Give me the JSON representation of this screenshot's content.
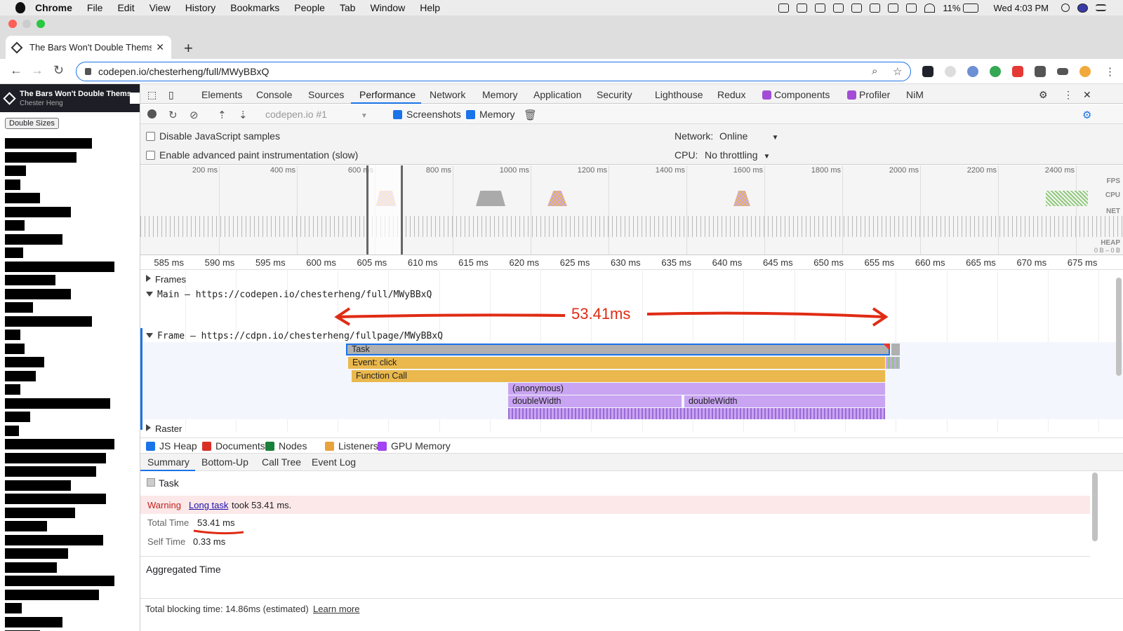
{
  "menubar": {
    "app": "Chrome",
    "items": [
      "File",
      "Edit",
      "View",
      "History",
      "Bookmarks",
      "People",
      "Tab",
      "Window",
      "Help"
    ],
    "battery": "11%",
    "clock": "Wed 4:03 PM"
  },
  "browser": {
    "tab_title": "The Bars Won't Double Thems",
    "url": "codepen.io/chesterheng/full/MWyBBxQ"
  },
  "page": {
    "header_title": "The Bars Won't Double Thems...",
    "header_author": "Chester Heng",
    "button_label": "Double Sizes",
    "bar_widths": [
      124,
      102,
      30,
      22,
      50,
      94,
      28,
      82,
      26,
      156,
      72,
      94,
      40,
      124,
      22,
      28,
      56,
      44,
      22,
      150,
      36,
      20,
      156,
      144,
      130,
      94,
      144,
      100,
      60,
      140,
      90,
      74,
      156,
      134,
      24,
      82,
      50,
      114
    ]
  },
  "devtools": {
    "tabs": [
      "Elements",
      "Console",
      "Sources",
      "Performance",
      "Network",
      "Memory",
      "Application",
      "Security",
      "Lighthouse",
      "Redux",
      "Components",
      "Profiler",
      "NiM"
    ],
    "active_tab": "Performance",
    "toolbar": {
      "target": "codepen.io #1",
      "screenshots_label": "Screenshots",
      "memory_label": "Memory"
    },
    "settings": {
      "disable_js_samples": "Disable JavaScript samples",
      "advanced_paint": "Enable advanced paint instrumentation (slow)",
      "network_label": "Network:",
      "network_value": "Online",
      "cpu_label": "CPU:",
      "cpu_value": "No throttling"
    },
    "overview": {
      "ticks": [
        "200 ms",
        "400 ms",
        "600 ms",
        "800 ms",
        "1000 ms",
        "1200 ms",
        "1400 ms",
        "1600 ms",
        "1800 ms",
        "2000 ms",
        "2200 ms",
        "2400 ms"
      ],
      "labels": {
        "fps": "FPS",
        "cpu": "CPU",
        "net": "NET",
        "heap": "HEAP",
        "heap_range": "0 B – 0 B"
      }
    },
    "ruler_ticks": [
      "585 ms",
      "590 ms",
      "595 ms",
      "600 ms",
      "605 ms",
      "610 ms",
      "615 ms",
      "620 ms",
      "625 ms",
      "630 ms",
      "635 ms",
      "640 ms",
      "645 ms",
      "650 ms",
      "655 ms",
      "660 ms",
      "665 ms",
      "670 ms",
      "675 ms"
    ],
    "tracks": {
      "frames": "Frames",
      "main": "Main — https://codepen.io/chesterheng/full/MWyBBxQ",
      "frame": "Frame — https://cdpn.io/chesterheng/fullpage/MWyBBxQ",
      "raster": "Raster"
    },
    "flame": {
      "task": "Task",
      "event": "Event: click",
      "function_call": "Function Call",
      "anonymous": "(anonymous)",
      "double_width_1": "doubleWidth",
      "double_width_2": "doubleWidth"
    },
    "annotation": "53.41ms",
    "legend": [
      "JS Heap",
      "Documents",
      "Nodes",
      "Listeners",
      "GPU Memory"
    ],
    "legend_colors": [
      "#1a73e8",
      "#d93025",
      "#188038",
      "#e8a33d",
      "#a142f4"
    ],
    "bottom_tabs": [
      "Summary",
      "Bottom-Up",
      "Call Tree",
      "Event Log"
    ],
    "summary": {
      "title": "Task",
      "warning_label": "Warning",
      "warning_link": "Long task",
      "warning_text": "took 53.41 ms.",
      "total_time_label": "Total Time",
      "total_time_value": "53.41 ms",
      "self_time_label": "Self Time",
      "self_time_value": "0.33 ms",
      "aggregated": "Aggregated Time"
    },
    "status_bar": {
      "text": "Total blocking time: 14.86ms (estimated)",
      "link": "Learn more"
    }
  },
  "colors": {
    "task": "#b0b0b0",
    "event": "#eab84c",
    "function": "#eab84c",
    "script_purple": "#c9a4f2",
    "annotation_red": "#e02b14"
  }
}
